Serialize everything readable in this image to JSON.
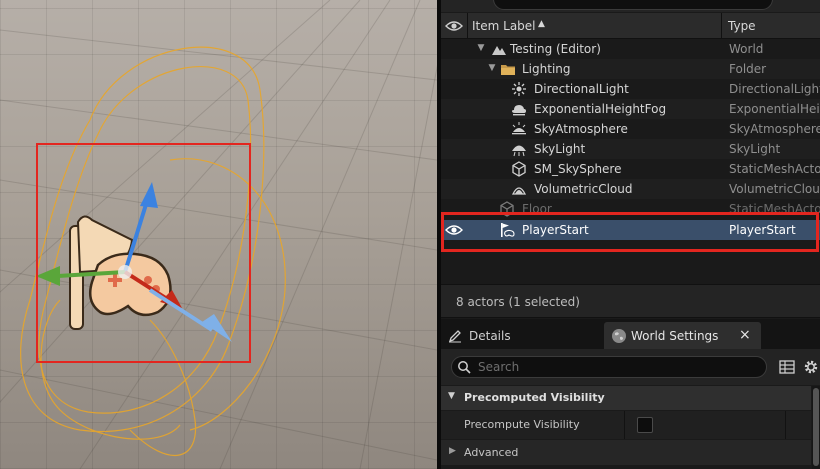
{
  "outliner": {
    "columns": {
      "item_label": "Item Label",
      "sort_indicator": "▲",
      "type": "Type"
    },
    "rows": [
      {
        "label": "Testing (Editor)",
        "type": "World",
        "icon": "world-icon"
      },
      {
        "label": "Lighting",
        "type": "Folder",
        "icon": "folder-icon"
      },
      {
        "label": "DirectionalLight",
        "type": "DirectionalLight",
        "icon": "directional-light-icon"
      },
      {
        "label": "ExponentialHeightFog",
        "type": "ExponentialHeig",
        "icon": "height-fog-icon"
      },
      {
        "label": "SkyAtmosphere",
        "type": "SkyAtmosphere",
        "icon": "sky-atmosphere-icon"
      },
      {
        "label": "SkyLight",
        "type": "SkyLight",
        "icon": "sky-light-icon"
      },
      {
        "label": "SM_SkySphere",
        "type": "StaticMeshActo",
        "icon": "static-mesh-icon"
      },
      {
        "label": "VolumetricCloud",
        "type": "VolumetricClouc",
        "icon": "volumetric-cloud-icon"
      },
      {
        "label": "Floor",
        "type": "StaticMeshActo",
        "icon": "static-mesh-icon"
      },
      {
        "label": "PlayerStart",
        "type": "PlayerStart",
        "icon": "player-start-icon",
        "selected": true
      }
    ],
    "actor_count": "8 actors (1 selected)"
  },
  "details": {
    "tabs": {
      "details": "Details",
      "world_settings": "World Settings",
      "close": "×"
    },
    "search_placeholder": "Search",
    "category_precomputed": "Precomputed Visibility",
    "property_precompute": "Precompute Visibility",
    "property_precompute_value": false,
    "category_advanced": "Advanced"
  },
  "colors": {
    "selection_highlight": "#e3261f",
    "selected_row": "#3a4f6a",
    "gizmo_x": "#c42a1a",
    "gizmo_y": "#5aa63a",
    "gizmo_z": "#3b82e0"
  }
}
